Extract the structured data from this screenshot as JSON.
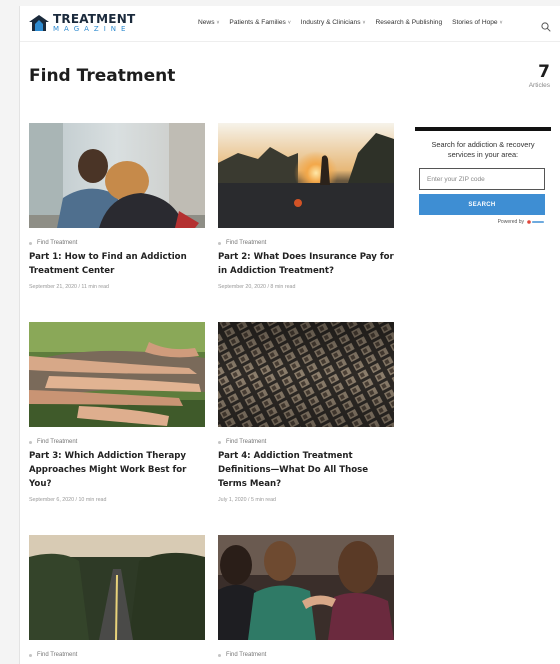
{
  "brand": {
    "line1": "TREATMENT",
    "line2": "MAGAZINE",
    "icon": "house-logo-icon",
    "colors": {
      "navy": "#1b2a3c",
      "blue": "#2f8bd0"
    }
  },
  "nav": {
    "items": [
      {
        "label": "News",
        "has_dropdown": true
      },
      {
        "label": "Patients & Families",
        "has_dropdown": true
      },
      {
        "label": "Industry & Clinicians",
        "has_dropdown": true
      },
      {
        "label": "Research & Publishing",
        "has_dropdown": false
      },
      {
        "label": "Stories of Hope",
        "has_dropdown": true
      }
    ],
    "chevron": "˅",
    "search_icon": "search-icon"
  },
  "page": {
    "title": "Find Treatment",
    "count": "7",
    "count_label": "Articles"
  },
  "articles": [
    {
      "category": "Find Treatment",
      "title": "Part 1: How to Find an Addiction Treatment Center",
      "meta": "September 21, 2020 / 11 min read",
      "image": "couple-embracing-photo"
    },
    {
      "category": "Find Treatment",
      "title": "Part 2: What Does Insurance Pay for in Addiction Treatment?",
      "meta": "September 20, 2020 / 8 min read",
      "image": "sunset-walker-photo"
    },
    {
      "category": "Find Treatment",
      "title": "Part 3: Which Addiction Therapy Approaches Might Work Best for You?",
      "meta": "September 6, 2020 / 10 min read",
      "image": "stacked-hands-photo"
    },
    {
      "category": "Find Treatment",
      "title": "Part 4: Addiction Treatment Definitions—What Do All Those Terms Mean?",
      "meta": "July 1, 2020 / 5 min read",
      "image": "letterpress-type-photo"
    },
    {
      "category": "Find Treatment",
      "title": "",
      "meta": "",
      "image": "winding-road-photo"
    },
    {
      "category": "Find Treatment",
      "title": "",
      "meta": "",
      "image": "support-group-photo"
    }
  ],
  "widget": {
    "text": "Search for addiction & recovery services in your area:",
    "zip_placeholder": "Enter your ZIP code",
    "zip_value": "",
    "search_label": "SEARCH",
    "powered_label": "Powered by",
    "accent": "#3e8ed3"
  }
}
